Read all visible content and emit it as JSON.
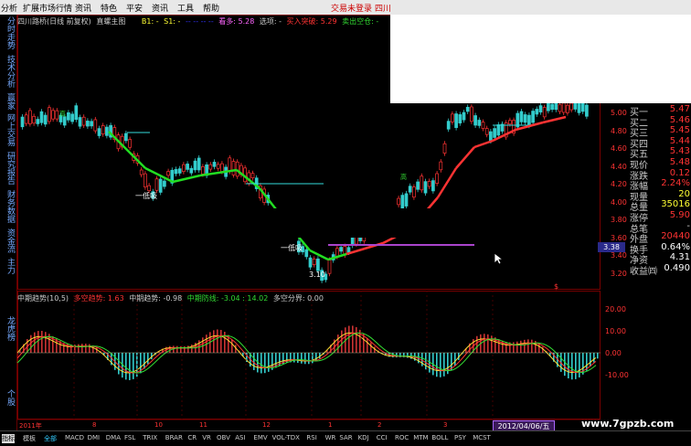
{
  "menu": {
    "items": [
      "分析",
      "扩展市场行情",
      "资讯",
      "特色",
      "平安",
      "资讯",
      "工具",
      "帮助"
    ],
    "trade_label": "交易未登录",
    "stock_short": "四川"
  },
  "left_tabs": [
    "分时走势",
    "技术分析",
    "赢家",
    "网上交易",
    "研究报告",
    "财务数据",
    "资金流",
    "主力",
    "龙虎榜",
    "个股"
  ],
  "legend": {
    "stock": "四川路桥(日线 前复权)",
    "formula": "直螺主图",
    "b1": "B1: -",
    "s1": "S1: -",
    "hidden": "-- -- -- --",
    "bull": "看多: 5.28",
    "select": "选项: -",
    "buy_break": "买入突破: 5.29",
    "sell_short": "卖出空仓: -"
  },
  "price_labels": {
    "low1": "一低吸",
    "low2": "一低吸",
    "low_price": "3.10",
    "tag1": "高",
    "tag2": "高"
  },
  "price_axis": [
    "5.00",
    "4.80",
    "4.60",
    "4.40",
    "4.20",
    "4.00",
    "3.80",
    "3.60",
    "3.40",
    "3.20"
  ],
  "indicator": {
    "name": "中期趋势(10,5)",
    "kong": "多空趋势: 1.63",
    "trend": "中期趋势: -0.98",
    "defense": "中期防线: -3.04 : 14.02",
    "boundary": "多空分界: 0.00"
  },
  "indicator_axis": [
    "20.00",
    "10.00",
    "0.00",
    "-10.00"
  ],
  "quote": {
    "rows": [
      {
        "k": "买一",
        "v": "5.47",
        "c": "#f33"
      },
      {
        "k": "买二",
        "v": "5.46",
        "c": "#f33"
      },
      {
        "k": "买三",
        "v": "5.45",
        "c": "#f33"
      },
      {
        "k": "买四",
        "v": "5.44",
        "c": "#f33"
      },
      {
        "k": "买五",
        "v": "5.43",
        "c": "#f33"
      },
      {
        "k": "现价",
        "v": "5.48",
        "c": "#f33"
      },
      {
        "k": "涨跌",
        "v": "0.12",
        "c": "#f33"
      },
      {
        "k": "涨幅",
        "v": "2.24%",
        "c": "#f33"
      },
      {
        "k": "现量",
        "v": "20",
        "c": "#ff3"
      },
      {
        "k": "总量",
        "v": "35016",
        "c": "#ff3"
      },
      {
        "k": "涨停",
        "v": "5.90",
        "c": "#f33"
      },
      {
        "k": "总笔",
        "v": "-",
        "c": "#ccc"
      },
      {
        "k": "外盘",
        "v": "20440",
        "c": "#f33"
      },
      {
        "k": "换手",
        "v": "0.64%",
        "c": "#fff"
      },
      {
        "k": "净资",
        "v": "4.31",
        "c": "#fff"
      },
      {
        "k": "收益㈣",
        "v": "0.490",
        "c": "#fff"
      }
    ]
  },
  "price_badge": "3.38",
  "dollar_mark": "$",
  "date_box": "2012/04/06/五",
  "x_axis": [
    "2011年",
    "8",
    "10",
    "11",
    "12",
    "1",
    "2",
    "3"
  ],
  "bottom_tabs": [
    "指标",
    "模板",
    "全部",
    "MACD",
    "DMI",
    "DMA",
    "FSL",
    "TRIX",
    "BRAR",
    "CR",
    "VR",
    "OBV",
    "ASI",
    "EMV",
    "VOL-TDX",
    "RSI",
    "WR",
    "SAR",
    "KDJ",
    "CCI",
    "ROC",
    "MTM",
    "BOLL",
    "PSY",
    "MCST"
  ],
  "watermark": "www.7gpzb.com",
  "colors": {
    "up": "#ff3333",
    "down": "#33cccc",
    "ma": "#22dd22",
    "line_cyan": "#33dddd",
    "line_purple": "#aa44cc"
  }
}
